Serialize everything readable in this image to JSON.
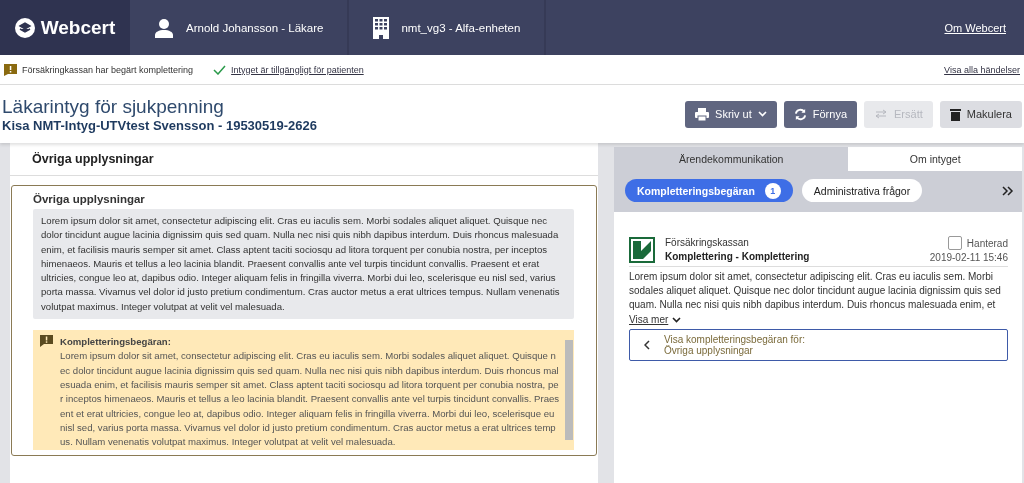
{
  "header": {
    "logo": "Webcert",
    "user": "Arnold Johansson - Läkare",
    "unit": "nmt_vg3 - Alfa-enheten",
    "about_link": "Om Webcert"
  },
  "status_bar": {
    "items": [
      {
        "kind": "warning",
        "text": "Försäkringkassan har begärt komplettering"
      },
      {
        "kind": "link",
        "text": "Intyget är tillgängligt för patienten"
      }
    ],
    "events_link": "Visa alla händelser"
  },
  "certificate": {
    "title": "Läkarintyg för sjukpenning",
    "patient": "Kisa NMT-Intyg-UTVtest Svensson - 19530519-2626"
  },
  "actions": [
    {
      "kind": "print",
      "label": "Skriv ut",
      "disabled": false,
      "dropdown": true
    },
    {
      "kind": "renew",
      "label": "Förnya",
      "disabled": false,
      "dropdown": false
    },
    {
      "kind": "replace",
      "label": "Ersätt",
      "disabled": true,
      "dropdown": false
    },
    {
      "kind": "delete",
      "label": "Makulera",
      "disabled": false,
      "dropdown": false
    }
  ],
  "section": {
    "heading": "Övriga upplysningar",
    "question": "Övriga upplysningar",
    "answer": "Lorem ipsum dolor sit amet, consectetur adipiscing elit. Cras eu iaculis sem. Morbi sodales aliquet aliquet. Quisque nec dolor tincidunt augue lacinia dignissim quis sed quam. Nulla nec nisi quis nibh dapibus interdum. Duis rhoncus malesuada enim, et facilisis mauris semper sit amet. Class aptent taciti sociosqu ad litora torquent per conubia nostra, per inceptos himenaeos. Mauris et tellus a leo lacinia blandit. Praesent convallis ante vel turpis tincidunt convallis. Praesent et erat ultricies, congue leo at, dapibus odio. Integer aliquam felis in fringilla viverra. Morbi dui leo, scelerisque eu nisl sed, varius porta massa. Vivamus vel dolor id justo pretium condimentum. Cras auctor metus a erat ultrices tempus. Nullam venenatis volutpat maximus. Integer volutpat at velit vel malesuada.",
    "request": {
      "title": "Kompletteringsbegäran:",
      "text": "Lorem ipsum dolor sit amet, consectetur adipiscing elit. Cras eu iaculis sem. Morbi sodales aliquet aliquet. Quisque nec dolor tincidunt augue lacinia dignissim quis sed quam. Nulla nec nisi quis nibh dapibus interdum. Duis rhoncus malesuada enim, et facilisis mauris semper sit amet. Class aptent taciti sociosqu ad litora torquent per conubia nostra, per inceptos himenaeos. Mauris et tellus a leo lacinia blandit. Praesent convallis ante vel turpis tincidunt convallis. Praesent et erat ultricies, congue leo at, dapibus odio. Integer aliquam felis in fringilla viverra. Morbi dui leo, scelerisque eu nisl sed, varius porta massa. Vivamus vel dolor id justo pretium condimentum. Cras auctor metus a erat ultrices tempus. Nullam venenatis volutpat maximus. Integer volutpat at velit vel malesuada."
    }
  },
  "side_panel": {
    "tabs": [
      {
        "label": "Ärendekommunikation",
        "selected": true
      },
      {
        "label": "Om intyget",
        "selected": false
      }
    ],
    "filters": [
      {
        "label": "Kompletteringsbegäran",
        "count": "1",
        "selected": true
      },
      {
        "label": "Administrativa frågor",
        "selected": false
      }
    ],
    "message": {
      "sender": "Försäkringskassan",
      "subject": "Komplettering - Komplettering",
      "handled_label": "Hanterad",
      "handled": false,
      "date": "2019-02-11 15:46",
      "text": "Lorem ipsum dolor sit amet, consectetur adipiscing elit. Cras eu iaculis sem. Morbi sodales aliquet aliquet. Quisque nec dolor tincidunt augue lacinia dignissim quis sed quam. Nulla nec nisi quis nibh dapibus interdum. Duis rhoncus malesuada enim, et",
      "show_more": "Visa mer",
      "link_label": "Visa kompletteringsbegäran för:",
      "link_target": "Övriga upplysningar"
    }
  }
}
